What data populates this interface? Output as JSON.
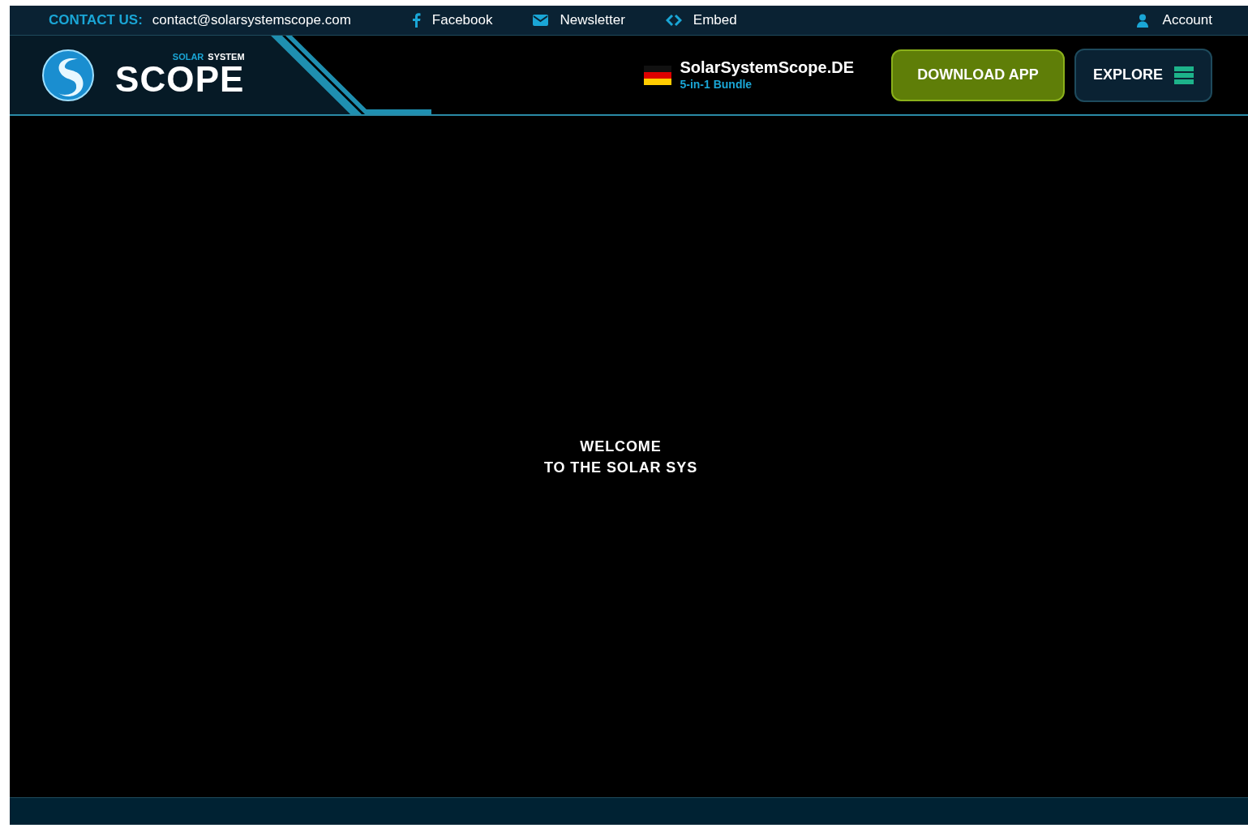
{
  "top_bar": {
    "contact_label": "CONTACT US:",
    "contact_email": "contact@solarsystemscope.com",
    "links": [
      {
        "kind": "facebook",
        "label": "Facebook"
      },
      {
        "kind": "newsletter",
        "label": "Newsletter"
      },
      {
        "kind": "embed",
        "label": "Embed"
      }
    ],
    "account": "Account"
  },
  "header": {
    "logo": {
      "small_1": "SOLAR",
      "small_2": "SYSTEM",
      "big": "SCOPE"
    },
    "promo": {
      "title": "SolarSystemScope.DE",
      "subtitle": "5-in-1 Bundle"
    },
    "download_button": "DOWNLOAD APP",
    "explore_button": "EXPLORE"
  },
  "main": {
    "lines": [
      "WELCOME",
      "TO THE SOLAR SYS"
    ]
  }
}
